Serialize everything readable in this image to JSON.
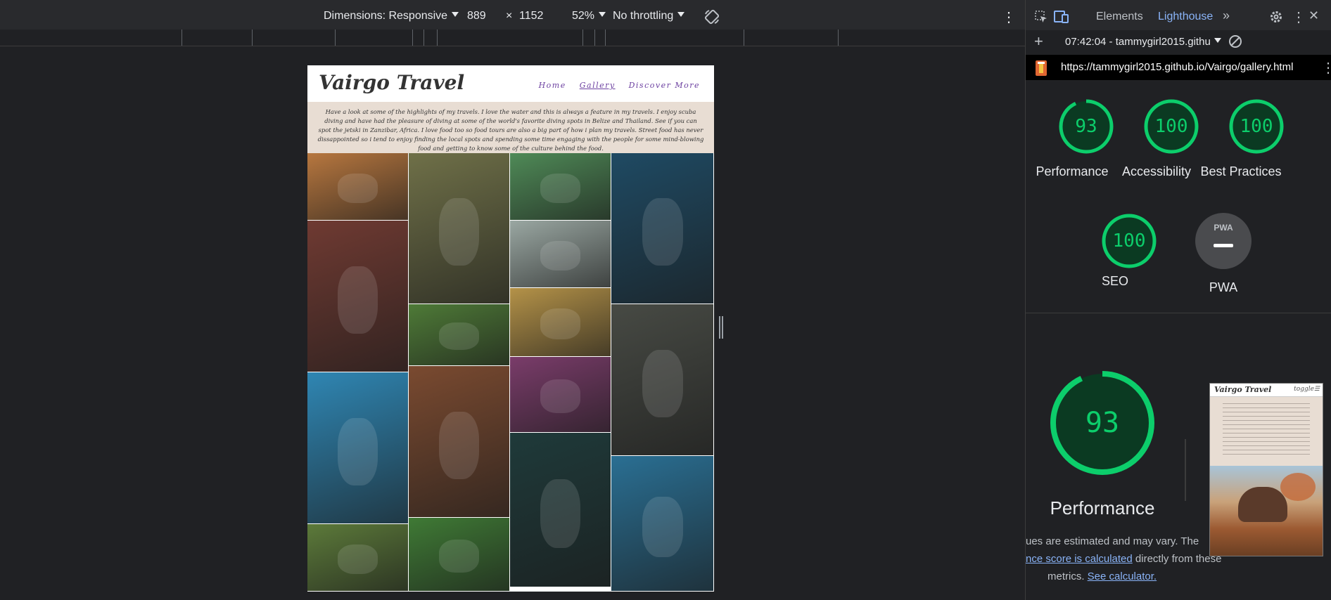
{
  "device_toolbar": {
    "dimensions_label": "Dimensions: Responsive",
    "width": "889",
    "times": "×",
    "height": "1152",
    "zoom": "52%",
    "throttling": "No throttling"
  },
  "site": {
    "title": "Vairgo Travel",
    "nav": [
      "Home",
      "Gallery",
      "Discover More"
    ],
    "intro": "Have a look at some of the highlights of my travels. I love the water and this is always a feature in my travels. I enjoy scuba diving and have had the pleasure of diving at some of the world's favorite diving spots in Belize and Thailand. See if you can spot the jetski in Zanzibar, Africa. I love food too so food tours are also a big part of how i plan my travels. Street food has never dissappointed so i tend to enjoy finding the local spots and spending some time engaging with the people for some mind-blowing food and getting to know some of the culture behind the food.",
    "gallery": [
      {
        "name": "elephant-photo",
        "color": "#b7773f"
      },
      {
        "name": "tree-jeep-photo",
        "color": "#6f7048"
      },
      {
        "name": "women-baskets-photo",
        "color": "#4f8a57"
      },
      {
        "name": "sea-turtle-photo",
        "color": "#1f4a63"
      },
      {
        "name": "banana-man-photo",
        "color": "#6f3a32"
      },
      {
        "name": "palm-beach-photo",
        "color": "#9aa7a2"
      },
      {
        "name": "zebras-photo",
        "color": "#4e7a37"
      },
      {
        "name": "rice-farmer-photo",
        "color": "#b49248"
      },
      {
        "name": "street-food-photo",
        "color": "#474a44"
      },
      {
        "name": "holi-colors-photo",
        "color": "#7a3c6a"
      },
      {
        "name": "jetski-photo",
        "color": "#2f86b3"
      },
      {
        "name": "temple-photo",
        "color": "#7a4a30"
      },
      {
        "name": "kitchen-fire-photo",
        "color": "#1f3a3a"
      },
      {
        "name": "dolphins-photo",
        "color": "#2a6f93"
      },
      {
        "name": "safari-camp-photo",
        "color": "#5c7a3a"
      },
      {
        "name": "tea-field-photo",
        "color": "#3f7a35"
      }
    ]
  },
  "devtools": {
    "tabs": [
      "Elements",
      "Lighthouse"
    ],
    "report_time": "07:42:04 - tammygirl2015.githu",
    "url": "https://tammygirl2015.github.io/Vairgo/gallery.html",
    "scores": [
      {
        "label": "Performance",
        "value": "93",
        "fraction": 0.93
      },
      {
        "label": "Accessibility",
        "value": "100",
        "fraction": 1.0
      },
      {
        "label": "Best Practices",
        "value": "100",
        "fraction": 1.0
      },
      {
        "label": "SEO",
        "value": "100",
        "fraction": 1.0
      }
    ],
    "pwa_label": "PWA",
    "pwa_badge": "PWA",
    "big_score": {
      "value": "93",
      "label": "Performance",
      "fraction": 0.93
    },
    "note_line1": "ues are estimated and may vary. The",
    "note_link1": "nce score is calculated",
    "note_line2": " directly from these",
    "note_line3": "metrics. ",
    "note_link2": "See calculator.",
    "thumb_title": "Vairgo Travel",
    "thumb_toggle": "toggle☰",
    "accent": "#0cce6b"
  }
}
